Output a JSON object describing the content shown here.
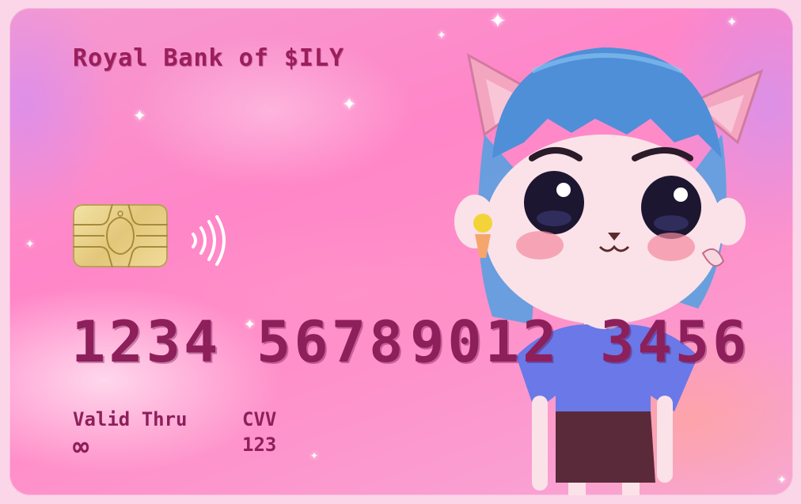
{
  "card": {
    "bank_name": "Royal Bank of $ILY",
    "number_groups": [
      "1234",
      "5678",
      "9012",
      "3456"
    ],
    "valid_thru_label": "Valid Thru",
    "valid_thru_value": "∞",
    "cvv_label": "CVV",
    "cvv_value": "123"
  },
  "icons": {
    "chip": "emv-chip-icon",
    "contactless": "contactless-icon",
    "mascot": "cat-girl-illustration"
  },
  "colors": {
    "text": "#8d1f5b",
    "card_base": "#ff8fc9",
    "chip_gold": "#e2c77a"
  }
}
